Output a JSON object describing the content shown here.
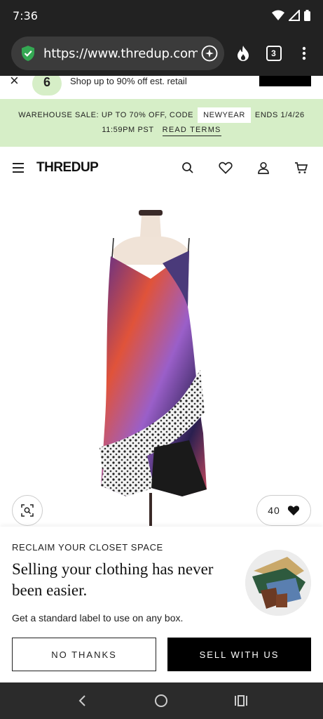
{
  "status_bar": {
    "time": "7:36"
  },
  "browser": {
    "url": "https://www.thredup.com/p",
    "tab_count": "3"
  },
  "top_promo": {
    "badge": "6",
    "text": "Shop up to 90% off est. retail"
  },
  "sale_banner": {
    "prefix": "WAREHOUSE SALE: UP TO 70% OFF, CODE",
    "code": "NEWYEAR",
    "ends": "ENDS 1/4/26",
    "time": "11:59PM PST",
    "read_terms": "READ TERMS",
    "bg_color": "#d6eec7"
  },
  "header": {
    "logo": "THREDUP"
  },
  "product": {
    "favorite_count": "40"
  },
  "sheet": {
    "kicker": "RECLAIM YOUR CLOSET SPACE",
    "heading": "Selling your clothing has never been easier.",
    "subtext": "Get a standard label to use on any box.",
    "no_thanks": "NO THANKS",
    "sell": "SELL WITH US"
  }
}
